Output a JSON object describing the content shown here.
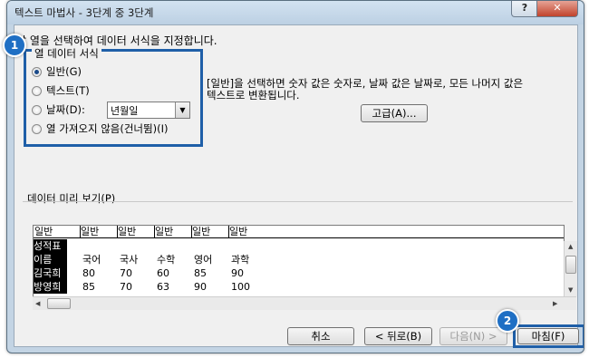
{
  "window": {
    "title": "텍스트 마법사 - 3단계 중 3단계",
    "help_label": "?",
    "close_label": "✕"
  },
  "instruction": "각 열을 선택하여 데이터 서식을 지정합니다.",
  "column_format": {
    "legend": "열 데이터 서식",
    "options": [
      {
        "label": "일반(G)",
        "selected": true
      },
      {
        "label": "텍스트(T)",
        "selected": false
      },
      {
        "label": "날짜(D):",
        "selected": false
      },
      {
        "label": "열 가져오지 않음(건너뜀)(I)",
        "selected": false
      }
    ],
    "date_format_value": "년월일"
  },
  "description": {
    "line1": "[일반]을 선택하면 숫자 값은 숫자로, 날짜 값은 날짜로, 모든 나머지 값은",
    "line2": "텍스트로 변환됩니다."
  },
  "advanced_button": "고급(A)...",
  "preview": {
    "label": "데이터 미리 보기(P)",
    "headers": [
      "일반",
      "일반",
      "일반",
      "일반",
      "일반",
      "일반"
    ],
    "rows": [
      [
        "성적표",
        "",
        "",
        "",
        "",
        ""
      ],
      [
        "이름",
        "국어",
        "국사",
        "수학",
        "영어",
        "과학"
      ],
      [
        "김국희",
        "80",
        "70",
        "60",
        "85",
        "90"
      ],
      [
        "방영희",
        "85",
        "70",
        "63",
        "90",
        "100"
      ]
    ]
  },
  "buttons": {
    "cancel": "취소",
    "back": "< 뒤로(B)",
    "next": "다음(N) >",
    "finish": "마침(F)"
  },
  "callouts": [
    "1",
    "2"
  ],
  "colors": {
    "accent": "#1f5fa8",
    "callout": "#1f6fc4",
    "window_frame": "#c3d4e4"
  }
}
